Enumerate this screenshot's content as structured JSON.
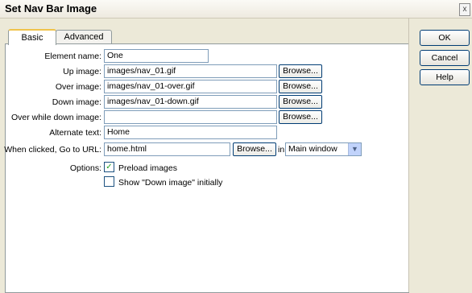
{
  "window": {
    "title": "Set Nav Bar Image",
    "close_glyph": "x"
  },
  "tabs": [
    {
      "label": "Basic"
    },
    {
      "label": "Advanced"
    }
  ],
  "form": {
    "element_name": {
      "label": "Element name:",
      "value": "One"
    },
    "up_image": {
      "label": "Up image:",
      "value": "images/nav_01.gif",
      "browse": "Browse..."
    },
    "over_image": {
      "label": "Over image:",
      "value": "images/nav_01-over.gif",
      "browse": "Browse..."
    },
    "down_image": {
      "label": "Down image:",
      "value": "images/nav_01-down.gif",
      "browse": "Browse..."
    },
    "over_while_down": {
      "label": "Over while down image:",
      "value": "",
      "browse": "Browse..."
    },
    "alternate_text": {
      "label": "Alternate text:",
      "value": "Home"
    },
    "go_to_url": {
      "label": "When clicked, Go to URL:",
      "value": "home.html",
      "browse": "Browse...",
      "in_label": "in",
      "target": "Main window"
    },
    "options": {
      "label": "Options:",
      "preload": {
        "label": "Preload images",
        "checked": true
      },
      "show_down": {
        "label": "Show \"Down image\" initially",
        "checked": false
      }
    }
  },
  "buttons": {
    "ok": "OK",
    "cancel": "Cancel",
    "help": "Help"
  }
}
